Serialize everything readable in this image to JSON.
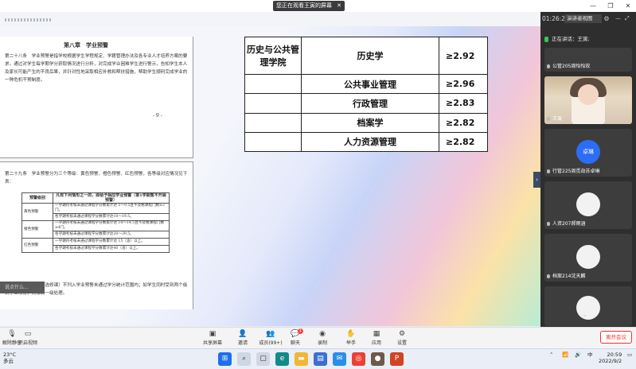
{
  "window": {
    "sharing_banner": "您正在观看王寅的屏幕",
    "banner_close": "✕",
    "controls": [
      "—",
      "❐",
      "✕"
    ]
  },
  "document": {
    "chapter_title": "第八章　学业预警",
    "article_28": "第二十八条　学业预警是指学校根据学生学程规定、学籍管理办法及各专业人才培养方案的要求，通过对学生每学期学分获取情况进行分析，对完成学业困难学生进行警示，告知学生本人及家长可能产生的不良后果，并针对性地采取相应补救和帮扶措施，帮助学生顺利完成学业的一种危机干预制度。",
    "page_number": "- 9 -",
    "article_29": "第二十九条　学业预警分为三个等级：黄色预警、橙色预警、红色预警，各等级对应情况见下表：",
    "table_header": [
      "预警级别",
      "凡有下列情形之一的，即给予相应学业预警（第1学期暂不开展预警）"
    ],
    "table_rows": [
      {
        "level": "黄色预警",
        "conds": [
          "一学期内考核未通过课程学分数累计达 5～9.5且不及格课程门数≥2门。",
          "各学期考核未通过课程学分数累计达10～19.5。"
        ]
      },
      {
        "level": "橙色预警",
        "conds": [
          "一学期内考核未通过课程学分数累计达 10～14.5且不及格课程门数≥4门。",
          "各学期考核未通过课程学分数累计达20～39.5。"
        ]
      },
      {
        "level": "红色预警",
        "conds": [
          "一学期内考核未通过课程学分数累计达 15（含）以上。",
          "各学期考核未通过课程学分数累计达40（含）以上。"
        ]
      }
    ],
    "note": "遗识类任选课程（校选修课）不列入学业预警未通过学分统计范围内；如学生同时受到两个级别学业预警，则按高一级处理。",
    "hint_box": "说点什么..."
  },
  "gpa_table": {
    "college": "历史与公共管理学院",
    "rows": [
      {
        "major": "历史学",
        "value": "≥2.92"
      },
      {
        "major": "公共事业管理",
        "value": "≥2.96"
      },
      {
        "major": "行政管理",
        "value": "≥2.83"
      },
      {
        "major": "档案学",
        "value": "≥2.82"
      },
      {
        "major": "人力资源管理",
        "value": "≥2.82"
      }
    ]
  },
  "panel": {
    "clock": "01:26:22",
    "view_mode": "演讲者视图",
    "speaking": "正在讲话：王寅;",
    "tiles": [
      {
        "name": "公管205周怡怡玫"
      },
      {
        "name": "王寅"
      },
      {
        "name": "行管225周觅劫苏卓琳",
        "avatar_text": "卓琳"
      },
      {
        "name": "人资207郝雨涵"
      },
      {
        "name": "档案214沈天麟"
      }
    ]
  },
  "toolbar": {
    "left": [
      {
        "label": "解除静音",
        "icon": "mic-icon"
      },
      {
        "label": "开启视频",
        "icon": "video-off-icon"
      }
    ],
    "center": [
      {
        "label": "共享屏幕",
        "icon": "screen-share-icon"
      },
      {
        "label": "邀请",
        "icon": "invite-icon"
      },
      {
        "label": "成员(99+)",
        "icon": "members-icon"
      },
      {
        "label": "聊天",
        "icon": "chat-icon",
        "badge": "1"
      },
      {
        "label": "录制",
        "icon": "record-icon"
      },
      {
        "label": "举手",
        "icon": "raise-hand-icon"
      },
      {
        "label": "应用",
        "icon": "apps-icon"
      },
      {
        "label": "设置",
        "icon": "settings-icon"
      }
    ],
    "end_button": "离开会议"
  },
  "taskbar": {
    "temperature": "23°C",
    "weather": "多云",
    "time": "20:59",
    "date": "2022/9/2",
    "ime": "中"
  }
}
